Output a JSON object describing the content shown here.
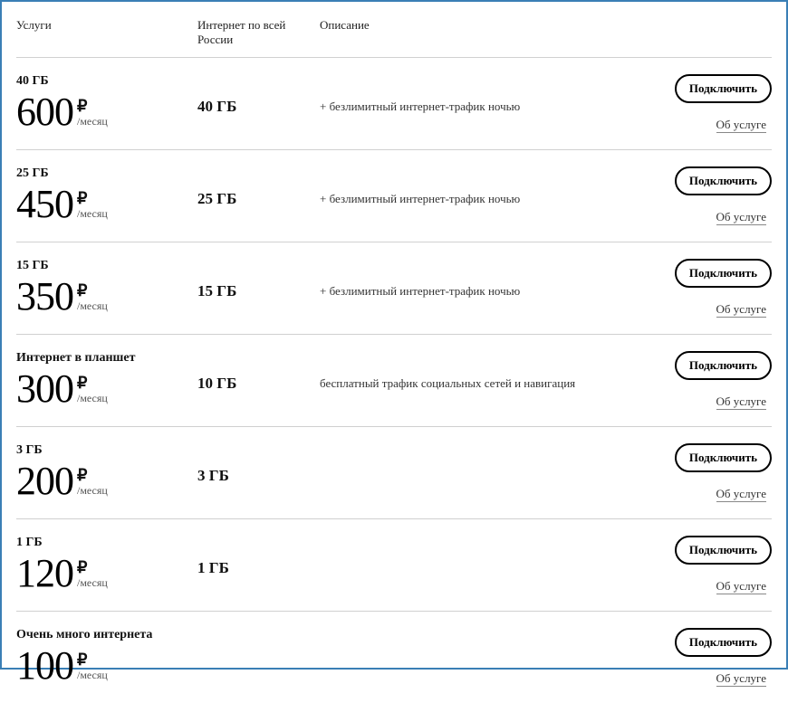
{
  "headers": {
    "service": "Услуги",
    "data_line1": "Интернет по всей",
    "data_line2": "России",
    "description": "Описание"
  },
  "currency_symbol": "₽",
  "per_month_label": "/месяц",
  "connect_label": "Подключить",
  "about_label": "Об услуге",
  "plans": [
    {
      "title": "40 ГБ",
      "price": "600",
      "data": "40 ГБ",
      "desc": "+ безлимитный интернет-трафик ночью"
    },
    {
      "title": "25 ГБ",
      "price": "450",
      "data": "25 ГБ",
      "desc": "+ безлимитный интернет-трафик ночью"
    },
    {
      "title": "15 ГБ",
      "price": "350",
      "data": "15 ГБ",
      "desc": "+ безлимитный интернет-трафик ночью"
    },
    {
      "title": "Интернет в планшет",
      "price": "300",
      "data": "10 ГБ",
      "desc": "бесплатный трафик социальных сетей и навигация"
    },
    {
      "title": "3 ГБ",
      "price": "200",
      "data": "3 ГБ",
      "desc": ""
    },
    {
      "title": "1 ГБ",
      "price": "120",
      "data": "1 ГБ",
      "desc": ""
    },
    {
      "title": "Очень много интернета",
      "price": "100",
      "data": "",
      "desc": ""
    }
  ]
}
